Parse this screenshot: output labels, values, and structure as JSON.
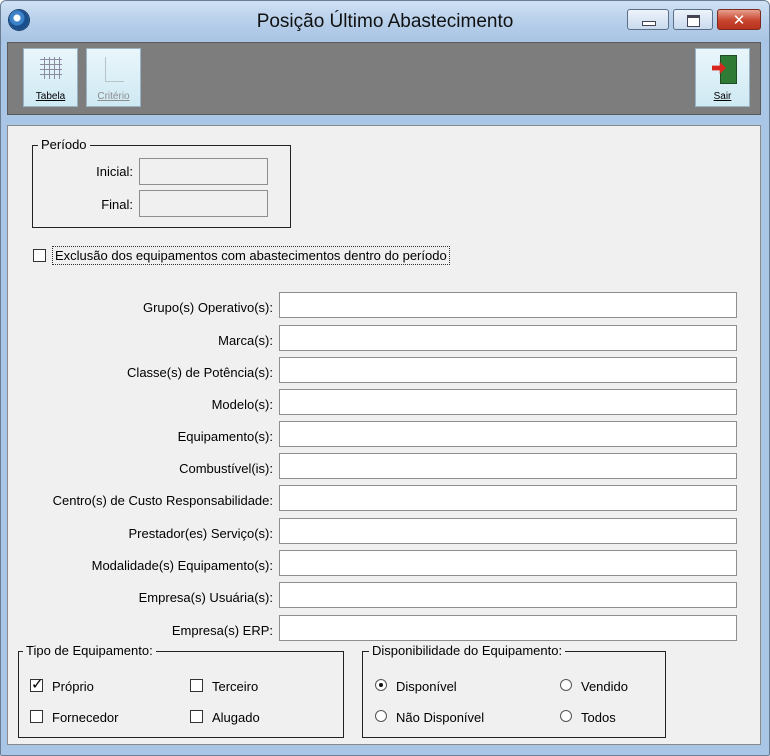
{
  "window": {
    "title": "Posição Último Abastecimento",
    "controls": {
      "minimize": "minimize",
      "maximize": "maximize",
      "close": "✕"
    }
  },
  "toolbar": {
    "tabela_label": "Tabela",
    "criterio_label": "Critério",
    "sair_label": "Sair"
  },
  "periodo": {
    "title": "Período",
    "inicial_label": "Inicial:",
    "inicial_value": "",
    "final_label": "Final:",
    "final_value": ""
  },
  "exclusion": {
    "label": "Exclusão dos equipamentos com abastecimentos dentro do período",
    "checked": false
  },
  "filters": [
    {
      "label": "Grupo(s) Operativo(s):",
      "value": ""
    },
    {
      "label": "Marca(s):",
      "value": ""
    },
    {
      "label": "Classe(s) de Potência(s):",
      "value": ""
    },
    {
      "label": "Modelo(s):",
      "value": ""
    },
    {
      "label": "Equipamento(s):",
      "value": ""
    },
    {
      "label": "Combustível(is):",
      "value": ""
    },
    {
      "label": "Centro(s) de Custo Responsabilidade:",
      "value": ""
    },
    {
      "label": "Prestador(es) Serviço(s):",
      "value": ""
    },
    {
      "label": "Modalidade(s) Equipamento(s):",
      "value": ""
    },
    {
      "label": "Empresa(s) Usuária(s):",
      "value": ""
    },
    {
      "label": "Empresa(s) ERP:",
      "value": ""
    }
  ],
  "tipo_equipamento": {
    "title": "Tipo de Equipamento:",
    "proprio": {
      "label": "Próprio",
      "checked": true
    },
    "terceiro": {
      "label": "Terceiro",
      "checked": false
    },
    "fornecedor": {
      "label": "Fornecedor",
      "checked": false
    },
    "alugado": {
      "label": "Alugado",
      "checked": false
    }
  },
  "disponibilidade": {
    "title": "Disponibilidade do Equipamento:",
    "disponivel": {
      "label": "Disponível",
      "selected": true
    },
    "vendido": {
      "label": "Vendido",
      "selected": false
    },
    "nao_disponivel": {
      "label": "Não Disponível",
      "selected": false
    },
    "todos": {
      "label": "Todos",
      "selected": false
    }
  }
}
